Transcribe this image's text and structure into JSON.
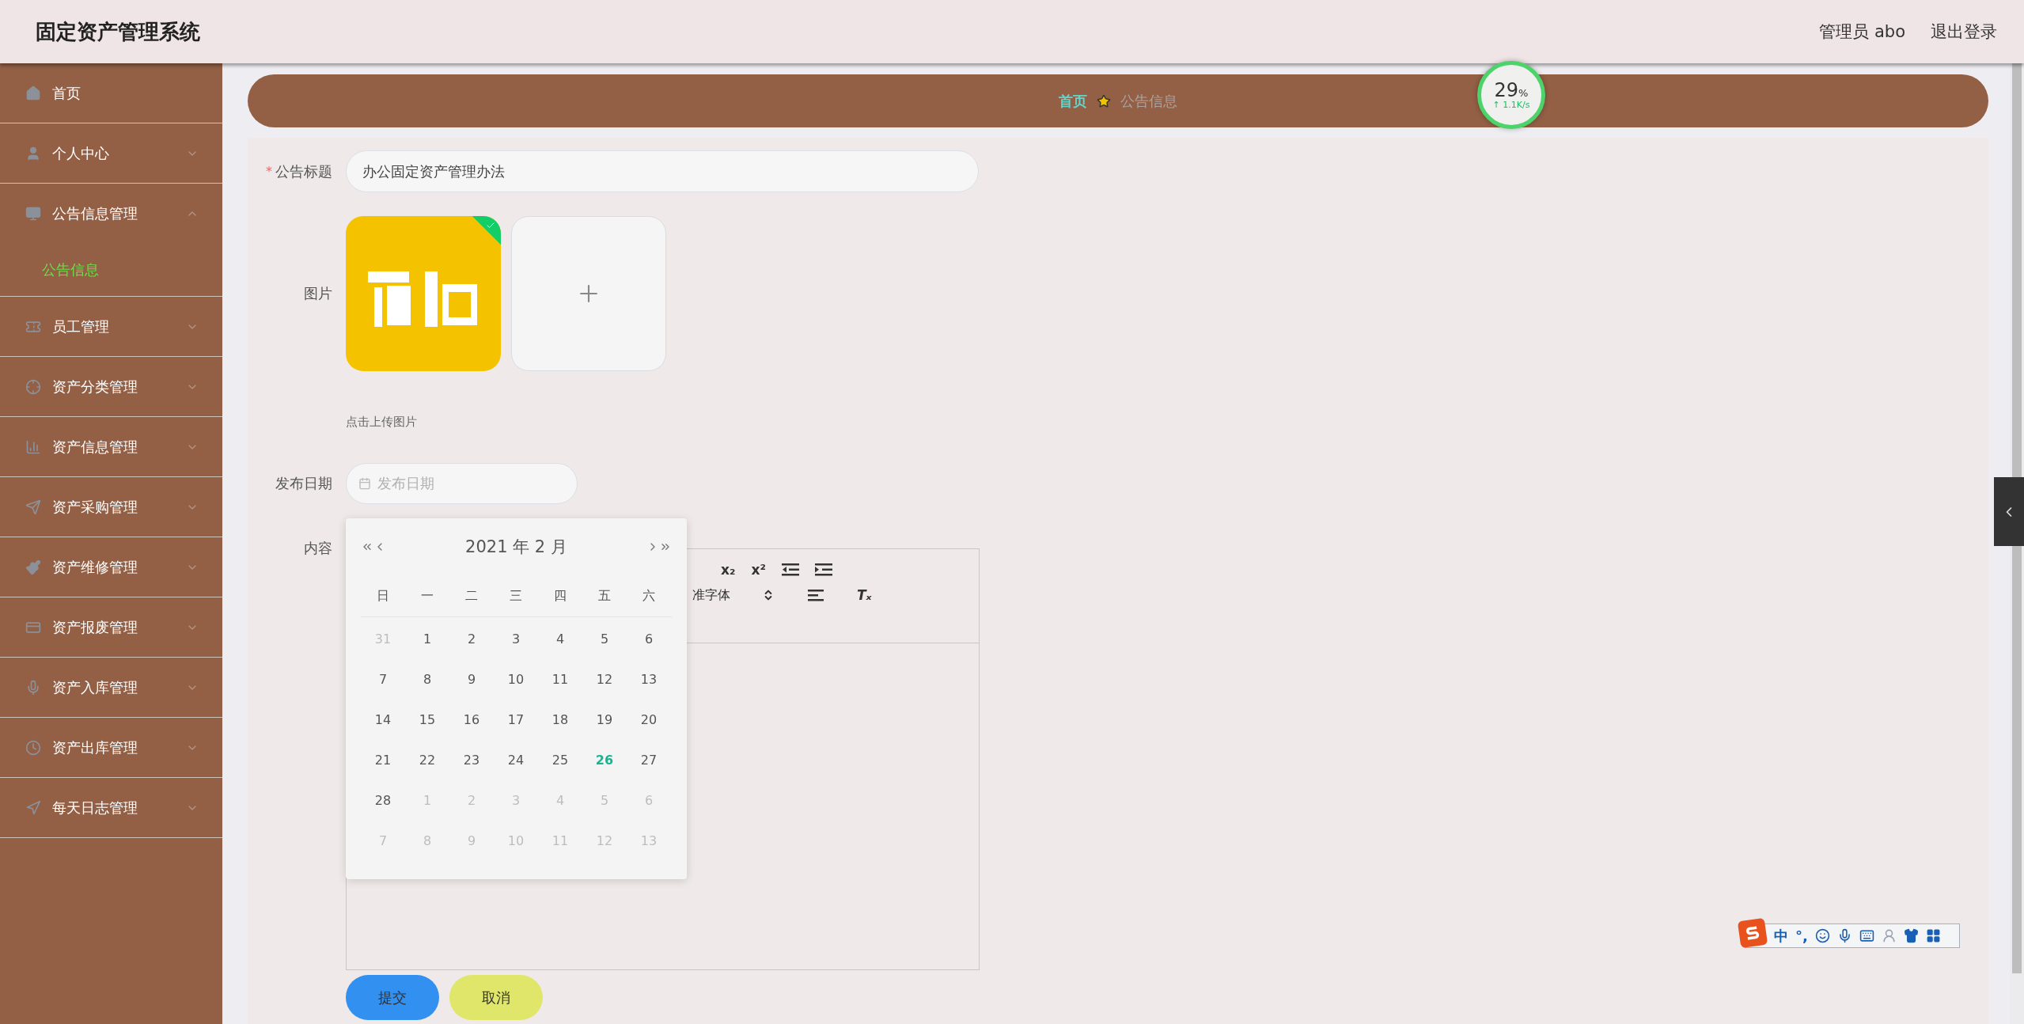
{
  "header": {
    "title": "固定资产管理系统",
    "user": "管理员 abo",
    "logout": "退出登录"
  },
  "sidebar": {
    "items": [
      {
        "label": "首页",
        "kind": "link"
      },
      {
        "label": "个人中心",
        "kind": "menu",
        "expanded": false
      },
      {
        "label": "公告信息管理",
        "kind": "menu",
        "expanded": true,
        "children": [
          {
            "label": "公告信息",
            "selected": true
          }
        ]
      },
      {
        "label": "员工管理",
        "kind": "menu",
        "expanded": false
      },
      {
        "label": "资产分类管理",
        "kind": "menu",
        "expanded": false
      },
      {
        "label": "资产信息管理",
        "kind": "menu",
        "expanded": false
      },
      {
        "label": "资产采购管理",
        "kind": "menu",
        "expanded": false
      },
      {
        "label": "资产维修管理",
        "kind": "menu",
        "expanded": false
      },
      {
        "label": "资产报废管理",
        "kind": "menu",
        "expanded": false
      },
      {
        "label": "资产入库管理",
        "kind": "menu",
        "expanded": false
      },
      {
        "label": "资产出库管理",
        "kind": "menu",
        "expanded": false
      },
      {
        "label": "每天日志管理",
        "kind": "menu",
        "expanded": false
      }
    ]
  },
  "breadcrumb": [
    {
      "label": "首页",
      "selected": false
    },
    {
      "label": "公告信息",
      "selected": true
    }
  ],
  "speed_widget": {
    "percent": "29",
    "unit": "%",
    "speed": "↑ 1.1K/s"
  },
  "form": {
    "title_field": {
      "label": "公告标题",
      "required_mark": "*",
      "value": "办公固定资产管理办法"
    },
    "image_field": {
      "label": "图片",
      "images": [
        {
          "kind": "picture",
          "uploaded": true
        }
      ],
      "hint": "点击上传图片"
    },
    "date_field": {
      "label": "发布日期",
      "placeholder": "发布日期"
    },
    "content_field": {
      "label": "内容",
      "toolbar": [
        [
          {
            "kind": "text",
            "text": "x₂"
          },
          {
            "kind": "text",
            "text": "x²"
          },
          {
            "kind": "outdent"
          },
          {
            "kind": "indent"
          }
        ],
        [
          {
            "kind": "select",
            "text": "准字体"
          },
          {
            "kind": "align"
          },
          {
            "kind": "clear_format",
            "text": "Tₓ"
          }
        ]
      ]
    },
    "buttons": [
      {
        "label": "提交",
        "kind": "primary"
      },
      {
        "label": "取消",
        "kind": "secondary"
      }
    ]
  },
  "calendar": {
    "title": "2021 年  2 月",
    "weekdays": [
      "日",
      "一",
      "二",
      "三",
      "四",
      "五",
      "六"
    ],
    "weeks": [
      [
        {
          "day": "31",
          "other_month": true,
          "selected": false
        },
        {
          "day": "1",
          "other_month": false,
          "selected": false
        },
        {
          "day": "2",
          "other_month": false,
          "selected": false
        },
        {
          "day": "3",
          "other_month": false,
          "selected": false
        },
        {
          "day": "4",
          "other_month": false,
          "selected": false
        },
        {
          "day": "5",
          "other_month": false,
          "selected": false
        },
        {
          "day": "6",
          "other_month": false,
          "selected": false
        }
      ],
      [
        {
          "day": "7",
          "other_month": false,
          "selected": false
        },
        {
          "day": "8",
          "other_month": false,
          "selected": false
        },
        {
          "day": "9",
          "other_month": false,
          "selected": false
        },
        {
          "day": "10",
          "other_month": false,
          "selected": false
        },
        {
          "day": "11",
          "other_month": false,
          "selected": false
        },
        {
          "day": "12",
          "other_month": false,
          "selected": false
        },
        {
          "day": "13",
          "other_month": false,
          "selected": false
        }
      ],
      [
        {
          "day": "14",
          "other_month": false,
          "selected": false
        },
        {
          "day": "15",
          "other_month": false,
          "selected": false
        },
        {
          "day": "16",
          "other_month": false,
          "selected": false
        },
        {
          "day": "17",
          "other_month": false,
          "selected": false
        },
        {
          "day": "18",
          "other_month": false,
          "selected": false
        },
        {
          "day": "19",
          "other_month": false,
          "selected": false
        },
        {
          "day": "20",
          "other_month": false,
          "selected": false
        }
      ],
      [
        {
          "day": "21",
          "other_month": false,
          "selected": false
        },
        {
          "day": "22",
          "other_month": false,
          "selected": false
        },
        {
          "day": "23",
          "other_month": false,
          "selected": false
        },
        {
          "day": "24",
          "other_month": false,
          "selected": false
        },
        {
          "day": "25",
          "other_month": false,
          "selected": false
        },
        {
          "day": "26",
          "other_month": false,
          "selected": true
        },
        {
          "day": "27",
          "other_month": false,
          "selected": false
        }
      ],
      [
        {
          "day": "28",
          "other_month": false,
          "selected": false
        },
        {
          "day": "1",
          "other_month": true,
          "selected": false
        },
        {
          "day": "2",
          "other_month": true,
          "selected": false
        },
        {
          "day": "3",
          "other_month": true,
          "selected": false
        },
        {
          "day": "4",
          "other_month": true,
          "selected": false
        },
        {
          "day": "5",
          "other_month": true,
          "selected": false
        },
        {
          "day": "6",
          "other_month": true,
          "selected": false
        }
      ],
      [
        {
          "day": "7",
          "other_month": true,
          "selected": false
        },
        {
          "day": "8",
          "other_month": true,
          "selected": false
        },
        {
          "day": "9",
          "other_month": true,
          "selected": false
        },
        {
          "day": "10",
          "other_month": true,
          "selected": false
        },
        {
          "day": "11",
          "other_month": true,
          "selected": false
        },
        {
          "day": "12",
          "other_month": true,
          "selected": false
        },
        {
          "day": "13",
          "other_month": true,
          "selected": false
        }
      ]
    ]
  },
  "ime_toolbar": {
    "mode": "中",
    "punctuation": "°,"
  }
}
